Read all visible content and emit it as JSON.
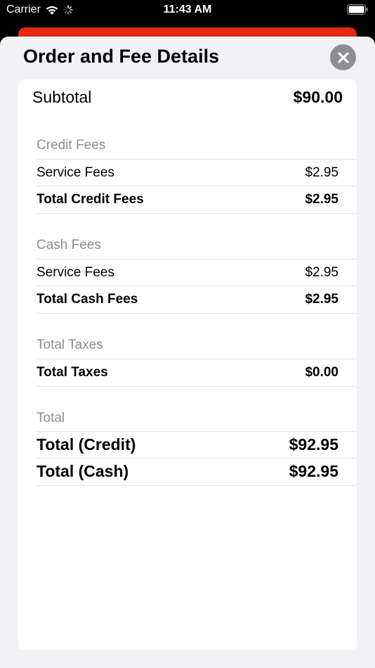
{
  "status_bar": {
    "carrier": "Carrier",
    "time": "11:43 AM"
  },
  "sheet": {
    "title": "Order and Fee Details",
    "close_icon": "close-icon"
  },
  "subtotal": {
    "label": "Subtotal",
    "amount": "$90.00"
  },
  "credit_fees": {
    "header": "Credit Fees",
    "service_label": "Service Fees",
    "service_amount": "$2.95",
    "total_label": "Total Credit Fees",
    "total_amount": "$2.95"
  },
  "cash_fees": {
    "header": "Cash Fees",
    "service_label": "Service Fees",
    "service_amount": "$2.95",
    "total_label": "Total Cash Fees",
    "total_amount": "$2.95"
  },
  "taxes": {
    "header": "Total Taxes",
    "total_label": "Total Taxes",
    "total_amount": "$0.00"
  },
  "totals": {
    "header": "Total",
    "credit_label": "Total (Credit)",
    "credit_amount": "$92.95",
    "cash_label": "Total (Cash)",
    "cash_amount": "$92.95"
  },
  "colors": {
    "accent": "#e5280e",
    "sheet_background": "#f2f1f6",
    "section_header": "#8e8e92",
    "close_button": "#8e8e92"
  }
}
